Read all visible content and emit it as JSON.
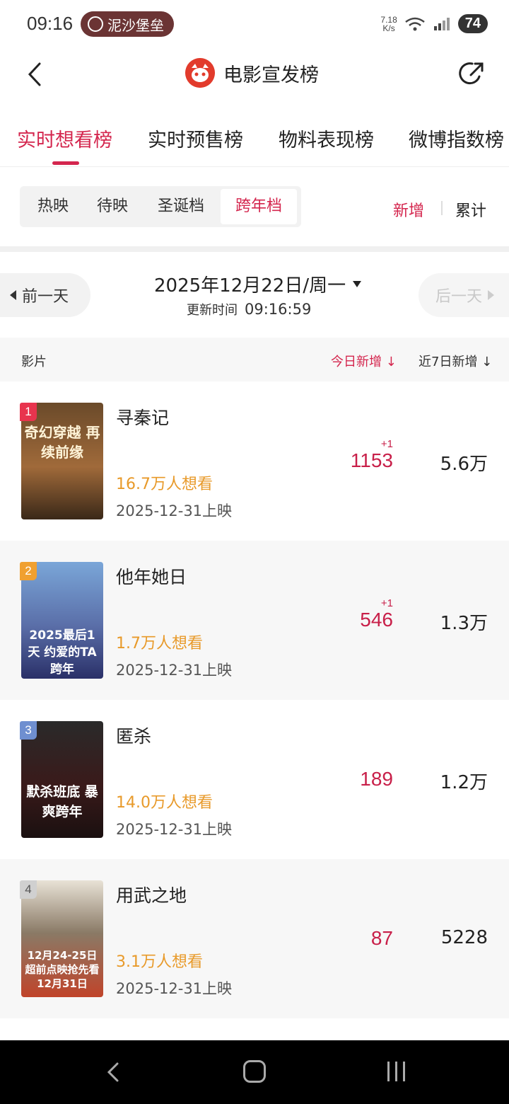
{
  "status": {
    "time": "09:16",
    "pill": "泥沙堡垒",
    "net_speed": "7.18",
    "net_unit": "K/s",
    "battery": "74"
  },
  "header": {
    "title": "电影宣发榜"
  },
  "tabs": [
    "实时想看榜",
    "实时预售榜",
    "物料表现榜",
    "微博指数榜"
  ],
  "segments": [
    "热映",
    "待映",
    "圣诞档",
    "跨年档"
  ],
  "toggle": {
    "new": "新增",
    "total": "累计"
  },
  "date_nav": {
    "prev": "前一天",
    "date": "2025年12月22日/周一",
    "next": "后一天",
    "update_label": "更新时间",
    "update_time": "09:16:59"
  },
  "columns": {
    "film": "影片",
    "today": "今日新增",
    "week": "近7日新增"
  },
  "movies": [
    {
      "rank": "1",
      "title": "寻秦记",
      "wish": "16.7万人想看",
      "date": "2025-12-31上映",
      "today": "1153",
      "today_plus": "+1",
      "week": "5.6万",
      "poster_text": "奇幻穿越 再续前缘"
    },
    {
      "rank": "2",
      "title": "他年她日",
      "wish": "1.7万人想看",
      "date": "2025-12-31上映",
      "today": "546",
      "today_plus": "+1",
      "week": "1.3万",
      "poster_text": "2025最后1天 约爱的TA跨年"
    },
    {
      "rank": "3",
      "title": "匿杀",
      "wish": "14.0万人想看",
      "date": "2025-12-31上映",
      "today": "189",
      "today_plus": "",
      "week": "1.2万",
      "poster_text": "默杀班底 暴爽跨年"
    },
    {
      "rank": "4",
      "title": "用武之地",
      "wish": "3.1万人想看",
      "date": "2025-12-31上映",
      "today": "87",
      "today_plus": "",
      "week": "5228",
      "poster_text": "12月24-25日 超前点映抢先看 12月31日"
    }
  ],
  "colors": {
    "accent": "#d4264e",
    "wish": "#e89a2a",
    "rank1": "#e8344e",
    "rank2": "#f0a030",
    "rank3": "#6f8fd0",
    "rank4": "#d0d0d0"
  }
}
